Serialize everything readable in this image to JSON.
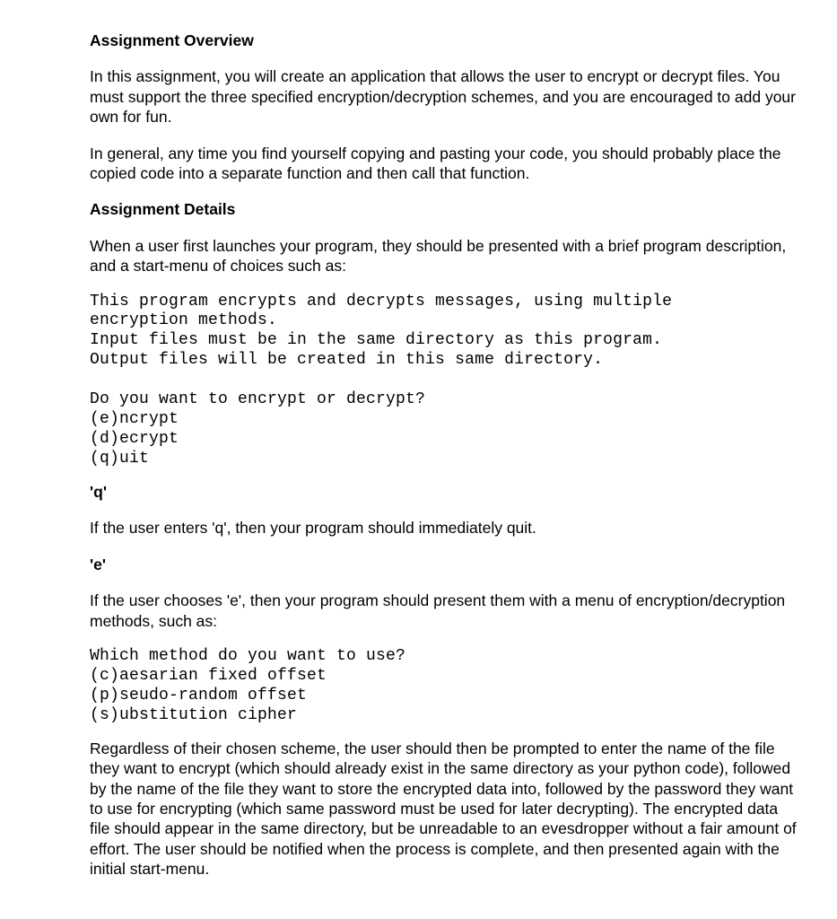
{
  "overview": {
    "heading": "Assignment Overview",
    "p1": "In this assignment, you will create an application that allows the user to encrypt or decrypt files. You must support the three specified encryption/decryption schemes, and you are encouraged to add your own for fun.",
    "p2": "In general, any time you find yourself copying and pasting your code, you should probably place the copied code into a separate function and then call that function."
  },
  "details": {
    "heading": "Assignment Details",
    "p1": "When a user first launches your program, they should be presented with a brief program description, and a start-menu of choices such as:",
    "code1": "This program encrypts and decrypts messages, using multiple\nencryption methods.\nInput files must be in the same directory as this program.\nOutput files will be created in this same directory.\n\nDo you want to encrypt or decrypt?\n(e)ncrypt\n(d)ecrypt\n(q)uit",
    "q_heading": "'q'",
    "q_para": "If the user enters 'q', then your program should immediately quit.",
    "e_heading": "'e'",
    "e_para": "If the user chooses 'e', then your program should present them with a menu of encryption/decryption methods, such as:",
    "code2": "Which method do you want to use?\n(c)aesarian fixed offset\n(p)seudo-random offset\n(s)ubstitution cipher",
    "p_final": "Regardless of their chosen scheme, the user should then be prompted to enter the name of the file they want to encrypt (which should already exist in the same directory as your python code), followed by the name of the file they want to store the encrypted data into, followed by the password they want to use for encrypting (which same password must be used for later decrypting). The encrypted data file should appear in the same directory, but be unreadable to an evesdropper without a fair amount of effort. The user should be notified when the process is complete, and then presented again with the initial start-menu."
  }
}
